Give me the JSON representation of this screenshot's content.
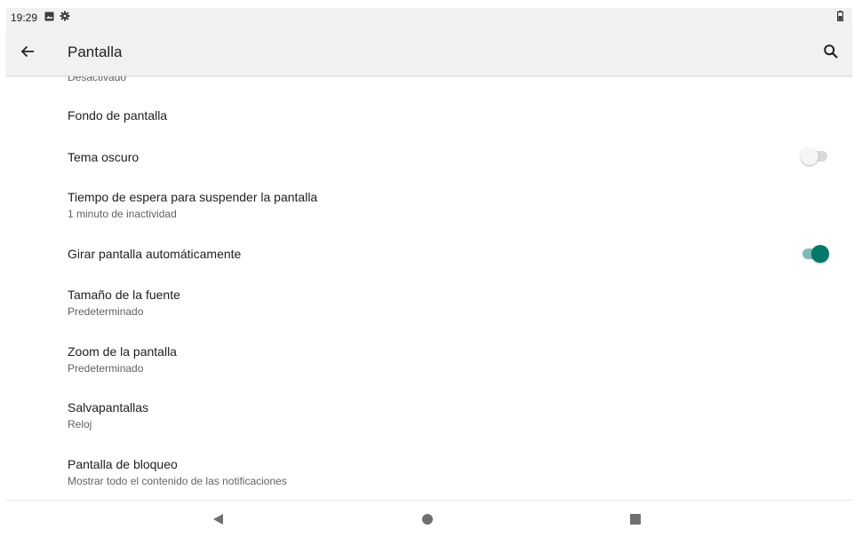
{
  "status_bar": {
    "time": "19:29",
    "icons": [
      "image-icon",
      "gear-icon"
    ],
    "right_icon": "battery-icon"
  },
  "app_bar": {
    "title": "Pantalla",
    "back_icon": "arrow-left-icon",
    "search_icon": "search-icon"
  },
  "list": {
    "partial_summary": "Desactivado",
    "items": [
      {
        "title": "Fondo de pantalla",
        "summary": ""
      },
      {
        "title": "Tema oscuro",
        "summary": "",
        "toggle": "off"
      },
      {
        "title": "Tiempo de espera para suspender la pantalla",
        "summary": "1 minuto de inactividad"
      },
      {
        "title": "Girar pantalla automáticamente",
        "summary": "",
        "toggle": "on"
      },
      {
        "title": "Tamaño de la fuente",
        "summary": "Predeterminado"
      },
      {
        "title": "Zoom de la pantalla",
        "summary": "Predeterminado"
      },
      {
        "title": "Salvapantallas",
        "summary": "Reloj"
      },
      {
        "title": "Pantalla de bloqueo",
        "summary": "Mostrar todo el contenido de las notificaciones"
      }
    ]
  },
  "nav_bar": {
    "buttons": [
      "back-triangle-icon",
      "home-circle-icon",
      "recents-square-icon"
    ]
  },
  "colors": {
    "accent": "#00796b",
    "accent_track": "#80bcb6",
    "bar_background": "#f1f1f1"
  }
}
